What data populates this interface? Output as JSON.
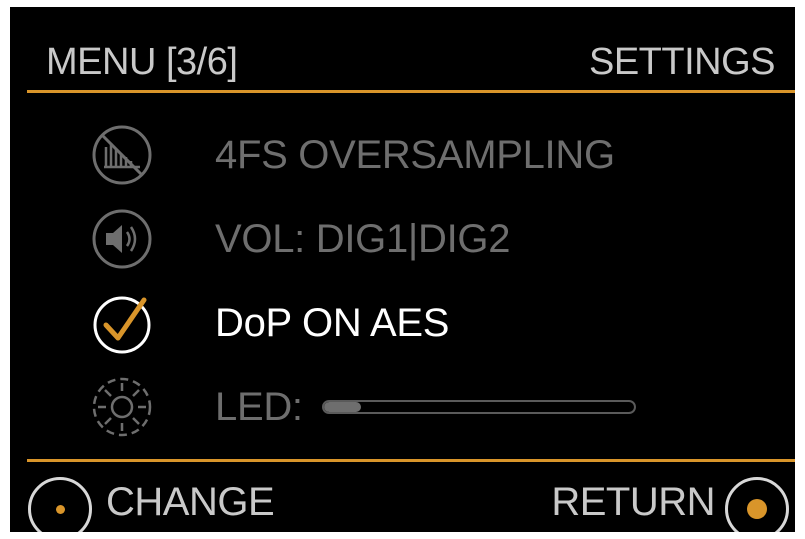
{
  "header": {
    "menu_label": "MENU [3/6]",
    "section_title": "SETTINGS"
  },
  "menu_items": [
    {
      "label": "4FS OVERSAMPLING",
      "icon": "oversampling-off-icon",
      "state": "dim"
    },
    {
      "label": "VOL: DIG1|DIG2",
      "icon": "speaker-icon",
      "state": "dim"
    },
    {
      "label": "DoP ON AES",
      "icon": "checkmark-circle-icon",
      "state": "selected"
    },
    {
      "label": "LED:",
      "icon": "brightness-icon",
      "state": "dim",
      "slider_level": 0.12
    }
  ],
  "footer": {
    "left_label": "CHANGE",
    "right_label": "RETURN"
  },
  "colors": {
    "accent": "#d9952a",
    "background": "#000000",
    "text_active": "#ffffff",
    "text_dim": "#6e6e6e",
    "text_header": "#c9c9c9"
  }
}
